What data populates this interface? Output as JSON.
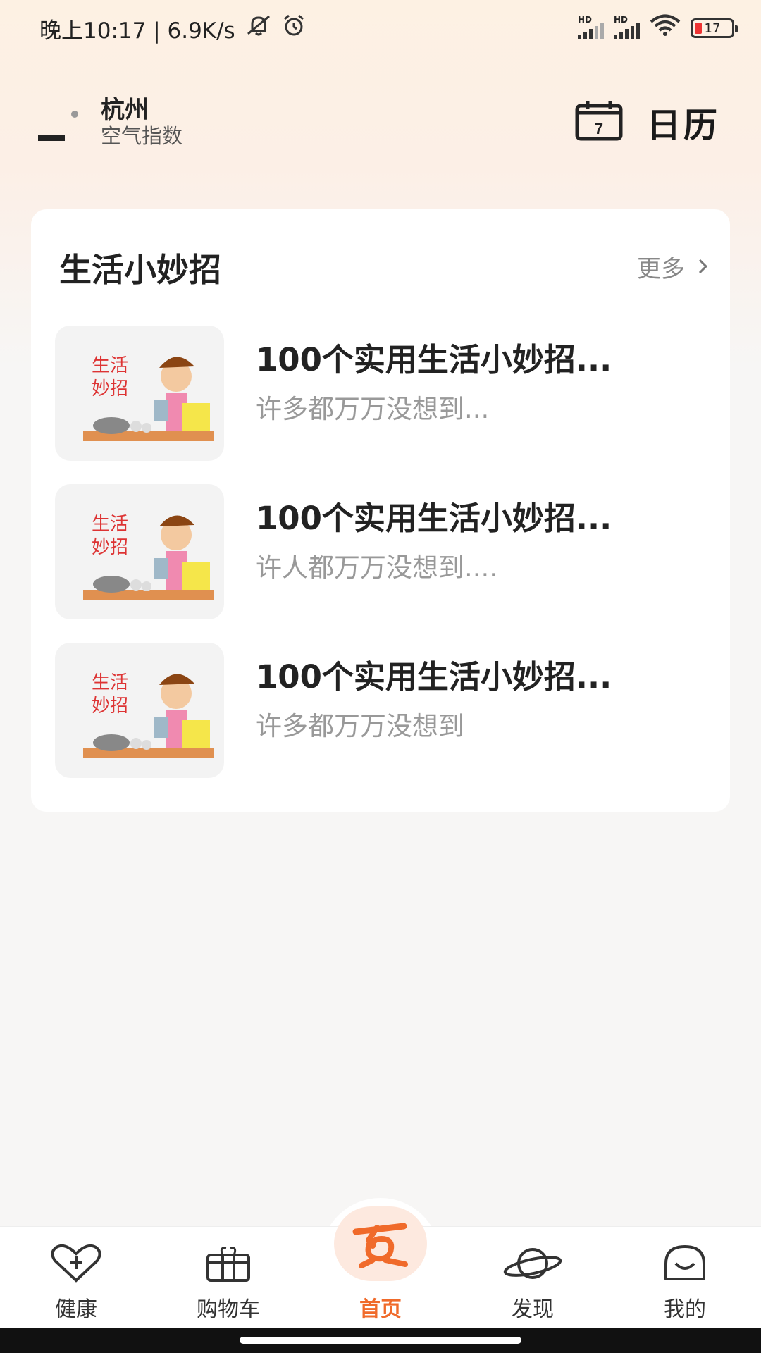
{
  "status_bar": {
    "time_speed": "晚上10:17 | 6.9K/s",
    "hd_label": "HD",
    "battery": "17"
  },
  "header": {
    "city": "杭州",
    "air_label": "空气指数",
    "calendar_day": "7",
    "calendar_label": "日历"
  },
  "card": {
    "title": "生活小妙招",
    "more_label": "更多",
    "items": [
      {
        "title": "100个实用生活小妙招...",
        "subtitle": "许多都万万没想到...",
        "thumb_text_line1": "生活",
        "thumb_text_line2": "妙招"
      },
      {
        "title": "100个实用生活小妙招...",
        "subtitle": "许人都万万没想到....",
        "thumb_text_line1": "生活",
        "thumb_text_line2": "妙招"
      },
      {
        "title": "100个实用生活小妙招...",
        "subtitle": "许多都万万没想到",
        "thumb_text_line1": "生活",
        "thumb_text_line2": "妙招"
      }
    ]
  },
  "bottom_nav": {
    "items": [
      {
        "label": "健康",
        "icon": "heart-plus-icon"
      },
      {
        "label": "购物车",
        "icon": "gift-box-icon"
      },
      {
        "label": "首页",
        "icon": "home-logo-icon",
        "active": true
      },
      {
        "label": "发现",
        "icon": "planet-icon"
      },
      {
        "label": "我的",
        "icon": "smile-face-icon"
      }
    ]
  },
  "colors": {
    "accent": "#f06a2a",
    "muted_text": "#999999",
    "card_bg": "#ffffff"
  }
}
